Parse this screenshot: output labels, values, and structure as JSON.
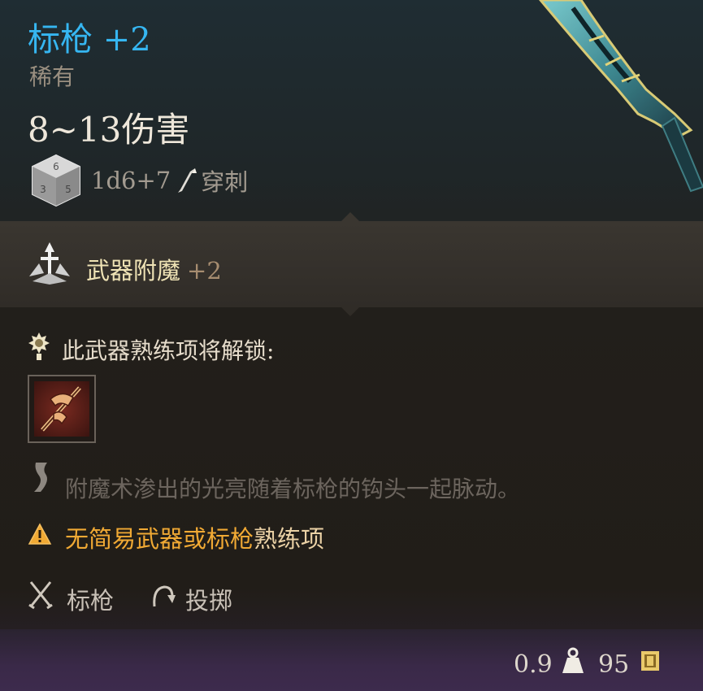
{
  "item": {
    "name": "标枪 +2",
    "rarity": "稀有",
    "damage": "8~13伤害",
    "dice": "1d6+7",
    "damage_type": "穿刺",
    "name_color": "#36b6f1"
  },
  "enchant": {
    "label": "武器附魔",
    "value": "+2"
  },
  "proficiency": {
    "text": "此武器熟练项将解锁:",
    "action_icon": "javelin-throw-action-icon"
  },
  "flavor": {
    "text": "附魔术渗出的光亮随着标枪的钩头一起脉动。"
  },
  "warning": {
    "highlight": "无简易武器或标枪",
    "rest": "熟练项",
    "color": "#f0a934"
  },
  "properties": [
    {
      "label": "标枪",
      "icon": "crossed-weapons-icon"
    },
    {
      "label": "投掷",
      "icon": "throw-icon"
    }
  ],
  "footer": {
    "weight": "0.9",
    "price": "95",
    "weight_icon": "weight-icon",
    "gold_icon": "gold-coin-icon"
  }
}
